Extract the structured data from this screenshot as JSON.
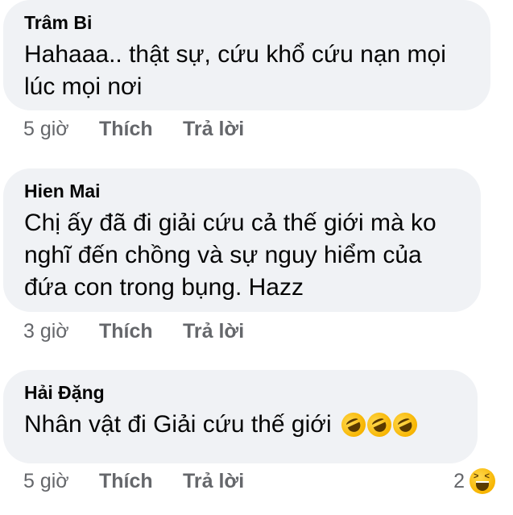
{
  "comments": [
    {
      "author": "Trâm Bi",
      "lines": [
        "Hahaaa.. thật sự, cứu khổ cứu nạn mọi",
        "lúc mọi nơi"
      ],
      "time": "5 giờ",
      "like_label": "Thích",
      "reply_label": "Trả lời"
    },
    {
      "author": "Hien Mai",
      "lines": [
        "Chị ấy đã đi giải cứu cả thế giới mà ko",
        "nghĩ đến chồng và sự nguy hiểm của",
        "đứa con trong bụng. Hazz"
      ],
      "time": "3 giờ",
      "like_label": "Thích",
      "reply_label": "Trả lời"
    },
    {
      "author": "Hải Đặng",
      "lines": [
        "Nhân vật đi Giải cứu thế giới"
      ],
      "emojis": [
        "rofl-emoji",
        "rofl-emoji",
        "rofl-emoji"
      ],
      "time": "5 giờ",
      "like_label": "Thích",
      "reply_label": "Trả lời",
      "reaction_count": "2",
      "reaction_icon": "laughing-emoji"
    }
  ]
}
